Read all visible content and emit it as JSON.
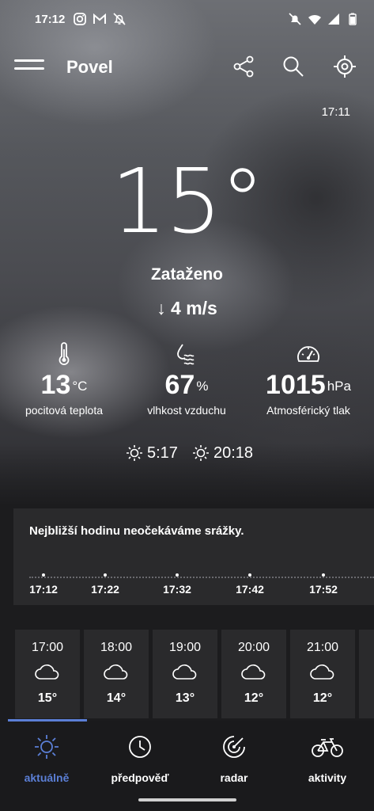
{
  "status": {
    "time": "17:12",
    "icons": [
      "instagram-icon",
      "gmail-icon",
      "alarm-off-icon",
      "mute-icon",
      "wifi-icon",
      "signal-icon",
      "battery-icon"
    ]
  },
  "appbar": {
    "title": "Povel",
    "actions": [
      "share-icon",
      "search-icon",
      "location-icon"
    ]
  },
  "current": {
    "updated": "17:11",
    "temperature": "15°",
    "condition": "Zataženo",
    "wind": "4 m/s"
  },
  "stats": [
    {
      "icon": "thermometer-icon",
      "value": "13",
      "unit": "°C",
      "label": "pocitová teplota"
    },
    {
      "icon": "humidity-icon",
      "value": "67",
      "unit": "%",
      "label": "vlhkost vzduchu"
    },
    {
      "icon": "gauge-icon",
      "value": "1015",
      "unit": "hPa",
      "label": "Atmosférický tlak"
    }
  ],
  "sun": {
    "sunrise": "5:17",
    "sunset": "20:18"
  },
  "precip": {
    "message": "Nejbližší hodinu neočekáváme srážky.",
    "times": [
      "17:12",
      "17:22",
      "17:32",
      "17:42",
      "17:52"
    ]
  },
  "hourly": [
    {
      "time": "17:00",
      "icon": "cloud-icon",
      "temp": "15°"
    },
    {
      "time": "18:00",
      "icon": "cloud-icon",
      "temp": "14°"
    },
    {
      "time": "19:00",
      "icon": "cloud-icon",
      "temp": "13°"
    },
    {
      "time": "20:00",
      "icon": "cloud-icon",
      "temp": "12°"
    },
    {
      "time": "21:00",
      "icon": "cloud-icon",
      "temp": "12°"
    }
  ],
  "nav": {
    "active_color": "#5b7fd6",
    "items": [
      {
        "label": "aktuálně",
        "icon": "sun-icon"
      },
      {
        "label": "předpověď",
        "icon": "clock-icon"
      },
      {
        "label": "radar",
        "icon": "radar-icon"
      },
      {
        "label": "aktivity",
        "icon": "bicycle-icon"
      }
    ]
  }
}
